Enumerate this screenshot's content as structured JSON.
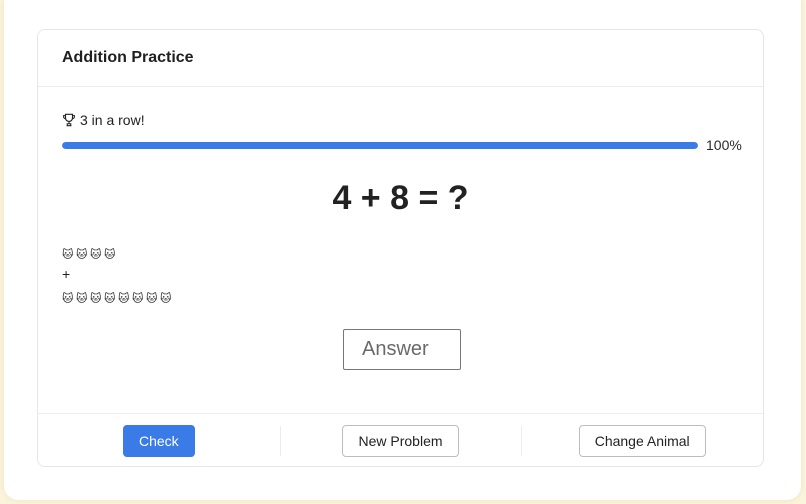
{
  "header": {
    "title": "Addition Practice"
  },
  "streak": {
    "icon": "trophy-icon",
    "text": "3 in a row!"
  },
  "progress": {
    "value_percent": 100,
    "label": "100%",
    "color": "#3a7be8"
  },
  "problem": {
    "text": "4 + 8 = ?",
    "addend_a": 4,
    "addend_b": 8
  },
  "visual": {
    "icon": "cat-face-icon",
    "emoji": "🐱",
    "group_a_count": 4,
    "operator": "+",
    "group_b_count": 8
  },
  "answer": {
    "placeholder": "Answer",
    "value": ""
  },
  "footer": {
    "check_label": "Check",
    "new_problem_label": "New Problem",
    "change_animal_label": "Change Animal"
  },
  "colors": {
    "accent": "#3a7be8",
    "background": "#fbf4dc"
  }
}
